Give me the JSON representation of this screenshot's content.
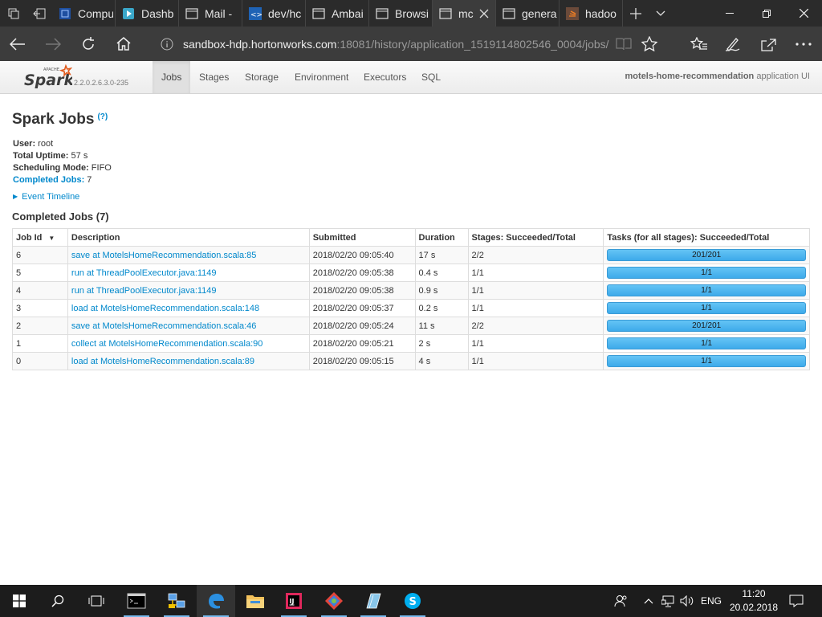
{
  "browser": {
    "tabs": [
      {
        "label": "Compu",
        "icon": "compute-icon"
      },
      {
        "label": "Dashb",
        "icon": "dashboard-icon"
      },
      {
        "label": "Mail -",
        "icon": "page-icon"
      },
      {
        "label": "dev/hc",
        "icon": "devops-icon"
      },
      {
        "label": "Ambai",
        "icon": "page-icon"
      },
      {
        "label": "Browsi",
        "icon": "page-icon"
      },
      {
        "label": "mc",
        "icon": "page-icon",
        "active": true
      },
      {
        "label": "genera",
        "icon": "page-icon"
      },
      {
        "label": "hadoo",
        "icon": "stackoverflow-icon"
      }
    ],
    "address": {
      "host": "sandbox-hdp.hortonworks.com",
      "rest": ":18081/history/application_1519114802546_0004/jobs/"
    }
  },
  "spark": {
    "logo_text": "Spark",
    "logo_small": "APACHE",
    "version": "2.2.0.2.6.3.0-235",
    "nav": [
      "Jobs",
      "Stages",
      "Storage",
      "Environment",
      "Executors",
      "SQL"
    ],
    "app_name": "motels-home-recommendation",
    "app_suffix": " application UI"
  },
  "page": {
    "title": "Spark Jobs",
    "help": "(?)",
    "user_label": "User:",
    "user": " root",
    "uptime_label": "Total Uptime:",
    "uptime": " 57 s",
    "sched_label": "Scheduling Mode:",
    "sched": " FIFO",
    "completed_label": "Completed Jobs:",
    "completed": " 7",
    "event_timeline": "Event Timeline",
    "section_title": "Completed Jobs (7)"
  },
  "table": {
    "headers": [
      "Job Id",
      "Description",
      "Submitted",
      "Duration",
      "Stages: Succeeded/Total",
      "Tasks (for all stages): Succeeded/Total"
    ],
    "rows": [
      {
        "id": "6",
        "desc": "save at MotelsHomeRecommendation.scala:85",
        "submitted": "2018/02/20 09:05:40",
        "duration": "17 s",
        "stages": "2/2",
        "tasks": "201/201",
        "tasks_fraction": 1.0
      },
      {
        "id": "5",
        "desc": "run at ThreadPoolExecutor.java:1149",
        "submitted": "2018/02/20 09:05:38",
        "duration": "0.4 s",
        "stages": "1/1",
        "tasks": "1/1",
        "tasks_fraction": 1.0
      },
      {
        "id": "4",
        "desc": "run at ThreadPoolExecutor.java:1149",
        "submitted": "2018/02/20 09:05:38",
        "duration": "0.9 s",
        "stages": "1/1",
        "tasks": "1/1",
        "tasks_fraction": 1.0
      },
      {
        "id": "3",
        "desc": "load at MotelsHomeRecommendation.scala:148",
        "submitted": "2018/02/20 09:05:37",
        "duration": "0.2 s",
        "stages": "1/1",
        "tasks": "1/1",
        "tasks_fraction": 1.0
      },
      {
        "id": "2",
        "desc": "save at MotelsHomeRecommendation.scala:46",
        "submitted": "2018/02/20 09:05:24",
        "duration": "11 s",
        "stages": "2/2",
        "tasks": "201/201",
        "tasks_fraction": 1.0
      },
      {
        "id": "1",
        "desc": "collect at MotelsHomeRecommendation.scala:90",
        "submitted": "2018/02/20 09:05:21",
        "duration": "2 s",
        "stages": "1/1",
        "tasks": "1/1",
        "tasks_fraction": 1.0
      },
      {
        "id": "0",
        "desc": "load at MotelsHomeRecommendation.scala:89",
        "submitted": "2018/02/20 09:05:15",
        "duration": "4 s",
        "stages": "1/1",
        "tasks": "1/1",
        "tasks_fraction": 1.0
      }
    ]
  },
  "taskbar": {
    "lang": "ENG",
    "time": "11:20",
    "date": "20.02.2018"
  },
  "colors": {
    "link": "#0088cc",
    "progress": "#3daaea",
    "chrome": "#2b2b2b"
  }
}
